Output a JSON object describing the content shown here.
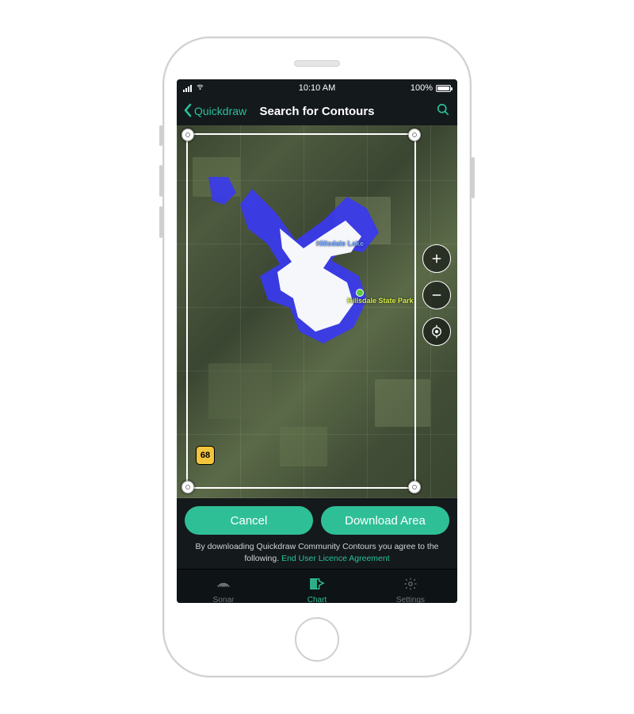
{
  "status": {
    "time": "10:10 AM",
    "battery_label": "100%"
  },
  "nav": {
    "back_label": "Quickdraw",
    "title": "Search for Contours"
  },
  "map": {
    "labels": {
      "lake": "Hillsdale Lake",
      "park": "Hillsdale State Park"
    },
    "route_badge": "68"
  },
  "actions": {
    "cancel": "Cancel",
    "download": "Download Area",
    "disclaimer_prefix": "By downloading Quickdraw Community Contours you agree to the following. ",
    "disclaimer_link": "End User Licence Agreement"
  },
  "tabs": {
    "sonar": "Sonar",
    "chart": "Chart",
    "settings": "Settings"
  }
}
